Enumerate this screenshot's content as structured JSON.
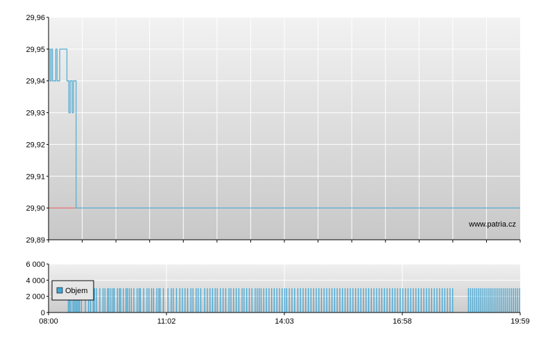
{
  "colors": {
    "price_line": "#5aaed3",
    "reference_line": "#e05050",
    "volume_bar": "#3fa7d6",
    "grid": "#ffffff",
    "axis": "#000000"
  },
  "chart_data": [
    {
      "type": "line",
      "watermark": "www.patria.cz",
      "ylim": [
        29.89,
        29.96
      ],
      "y_ticks": [
        "29,96",
        "29,95",
        "29,94",
        "29,93",
        "29,92",
        "29,91",
        "29,90",
        "29,89"
      ],
      "xlim_minutes": [
        480,
        1199
      ],
      "grid": true,
      "reference_value": 29.9,
      "series": [
        {
          "x_minutes": [
            480,
            482,
            482,
            484,
            484,
            486,
            486,
            491,
            491,
            493,
            493,
            497,
            497,
            508,
            508,
            511,
            511,
            513,
            513,
            516,
            516,
            518,
            518,
            522,
            522,
            1199
          ],
          "values": [
            29.95,
            29.95,
            29.94,
            29.94,
            29.95,
            29.95,
            29.94,
            29.94,
            29.95,
            29.95,
            29.94,
            29.94,
            29.95,
            29.95,
            29.94,
            29.94,
            29.93,
            29.93,
            29.94,
            29.94,
            29.93,
            29.93,
            29.94,
            29.94,
            29.9,
            29.9
          ]
        }
      ]
    },
    {
      "type": "bar",
      "ylim": [
        0,
        6000
      ],
      "y_ticks": [
        "6 000",
        "4 000",
        "2 000",
        "0"
      ],
      "x_tick_labels": [
        "08:00",
        "11:02",
        "14:03",
        "16:58",
        "19:59"
      ],
      "xlim_minutes": [
        480,
        1199
      ],
      "grid": true,
      "legend": {
        "label": "Objem",
        "placement": "left"
      },
      "bar_value": 3000,
      "bar_minutes": [
        510,
        512,
        514,
        517,
        519,
        521,
        523,
        525,
        527,
        530,
        536,
        541,
        544,
        548,
        550,
        553,
        558,
        563,
        566,
        570,
        572,
        575,
        578,
        580,
        585,
        588,
        590,
        594,
        598,
        600,
        603,
        606,
        610,
        615,
        618,
        620,
        625,
        630,
        633,
        637,
        640,
        645,
        648,
        650,
        655,
        662,
        667,
        670,
        675,
        680,
        684,
        688,
        692,
        697,
        700,
        705,
        708,
        712,
        718,
        722,
        726,
        730,
        734,
        737,
        742,
        746,
        750,
        755,
        758,
        762,
        766,
        770,
        775,
        778,
        782,
        786,
        790,
        795,
        798,
        801,
        804,
        808,
        812,
        816,
        820,
        824,
        828,
        832,
        836,
        840,
        843,
        847,
        851,
        855,
        860,
        864,
        868,
        872,
        876,
        880,
        884,
        888,
        892,
        896,
        900,
        904,
        908,
        912,
        916,
        920,
        924,
        928,
        932,
        936,
        940,
        944,
        948,
        952,
        956,
        960,
        964,
        968,
        972,
        976,
        980,
        984,
        988,
        992,
        996,
        1000,
        1004,
        1008,
        1012,
        1016,
        1020,
        1024,
        1028,
        1032,
        1036,
        1040,
        1044,
        1048,
        1052,
        1056,
        1060,
        1064,
        1068,
        1072,
        1076,
        1080,
        1084,
        1088,
        1092,
        1096,
        1120,
        1123,
        1126,
        1129,
        1132,
        1135,
        1138,
        1141,
        1144,
        1147,
        1150,
        1153,
        1156,
        1159,
        1162,
        1165,
        1168,
        1171,
        1174,
        1177,
        1180,
        1183,
        1186,
        1189,
        1192,
        1195,
        1198
      ]
    }
  ]
}
